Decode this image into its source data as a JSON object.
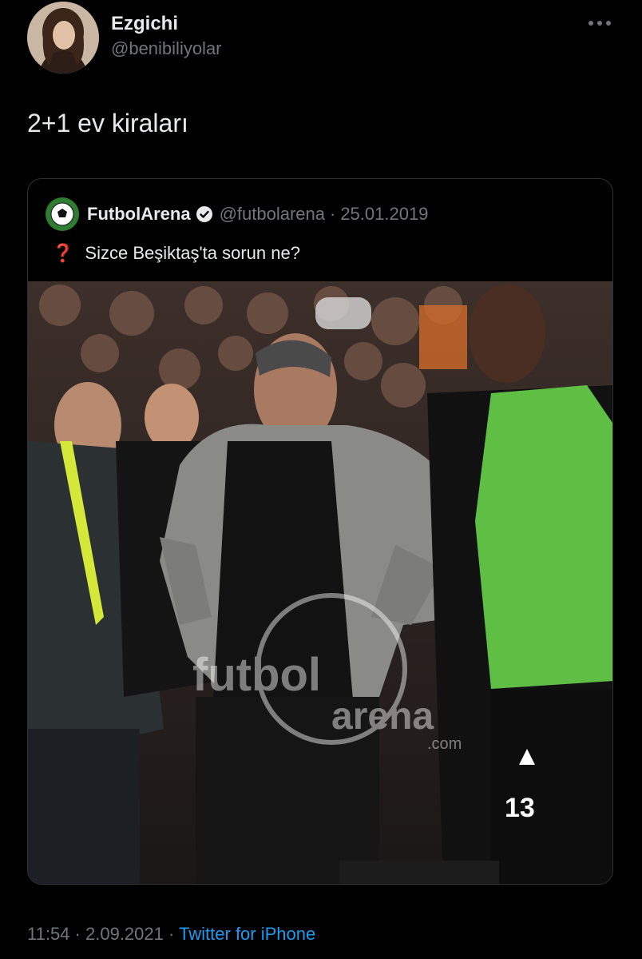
{
  "author": {
    "display_name": "Ezgichi",
    "handle": "@benibiliyolar"
  },
  "tweet": {
    "text": "2+1 ev kiraları"
  },
  "quoted_tweet": {
    "display_name": "FutbolArena",
    "handle": "@futbolarena",
    "separator": "·",
    "date": "25.01.2019",
    "question_mark": "❓",
    "text": "Sizce Beşiktaş'ta sorun ne?",
    "image": {
      "watermark_main": "futbol",
      "watermark_sub": "arena",
      "watermark_domain": ".com",
      "jersey_number": "13"
    }
  },
  "footer": {
    "time": "11:54",
    "separator": "·",
    "date": "2.09.2021",
    "separator2": "·",
    "source": "Twitter for iPhone"
  },
  "colors": {
    "background": "#000000",
    "text_primary": "#e7e9ea",
    "text_secondary": "#71767b",
    "link": "#1d9bf0",
    "border": "#2f3336",
    "bib_green": "#5fbf45"
  }
}
